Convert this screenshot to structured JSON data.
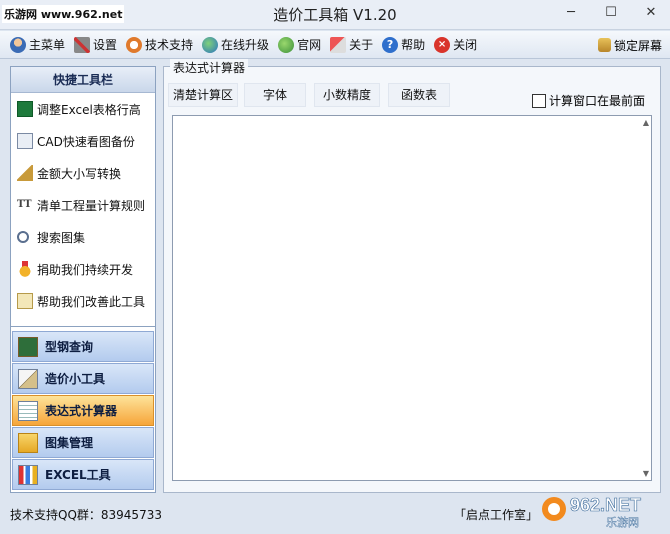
{
  "window": {
    "watermark_site": "乐游网 www.962.net",
    "title": "造价工具箱 V1.20",
    "minimize": "─",
    "maximize": "☐",
    "close": "✕"
  },
  "toolbar": {
    "items": [
      {
        "label": "主菜单",
        "icon": "user-icon"
      },
      {
        "label": "设置",
        "icon": "tools-icon"
      },
      {
        "label": "技术支持",
        "icon": "support-icon"
      },
      {
        "label": "在线升级",
        "icon": "globe-icon"
      },
      {
        "label": "官网",
        "icon": "earth-icon"
      },
      {
        "label": "关于",
        "icon": "about-icon"
      },
      {
        "label": "帮助",
        "icon": "help-icon"
      },
      {
        "label": "关闭",
        "icon": "close-icon"
      }
    ],
    "lock_label": "锁定屏幕"
  },
  "sidebar": {
    "header": "快捷工具栏",
    "quick_items": [
      {
        "label": "调整Excel表格行高",
        "icon": "excel-icon"
      },
      {
        "label": "CAD快速看图备份",
        "icon": "cad-icon"
      },
      {
        "label": "金额大小写转换",
        "icon": "ruler-icon"
      },
      {
        "label": "清单工程量计算规则",
        "icon": "tt-icon"
      },
      {
        "label": "搜索图集",
        "icon": "magnifier-icon"
      },
      {
        "label": "捐助我们持续开发",
        "icon": "medal-icon"
      },
      {
        "label": "帮助我们改善此工具",
        "icon": "edit-icon"
      }
    ],
    "nav_items": [
      {
        "label": "型钢查询",
        "icon": "chalkboard-icon"
      },
      {
        "label": "造价小工具",
        "icon": "triangle-ruler-icon"
      },
      {
        "label": "表达式计算器",
        "icon": "notebook-icon"
      },
      {
        "label": "图集管理",
        "icon": "folder-star-icon"
      },
      {
        "label": "EXCEL工具",
        "icon": "bar-chart-icon"
      }
    ],
    "active_nav": "表达式计算器",
    "tt_glyph": "TT"
  },
  "main": {
    "group_title": "表达式计算器",
    "buttons": [
      "清楚计算区",
      "字体",
      "小数精度",
      "函数表"
    ],
    "topmost_label": "计算窗口在最前面",
    "topmost_checked": false
  },
  "status": {
    "left": "技术支持QQ群：83945733",
    "right": "「启点工作室」"
  },
  "brand_logo": {
    "text": "962.NET",
    "subtext": "乐游网"
  },
  "colors": {
    "accent": "#f6a53a",
    "nav_blue": "#b3cbee",
    "title_bg": "#e9eef6"
  }
}
